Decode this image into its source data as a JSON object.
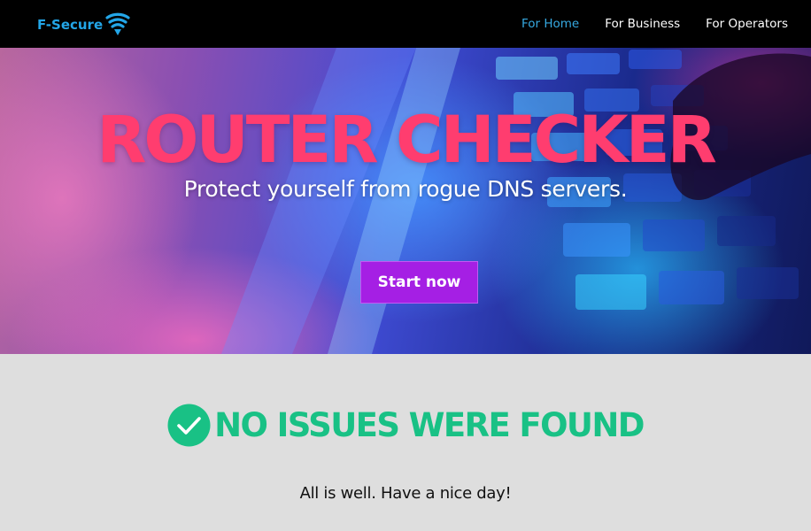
{
  "header": {
    "logo_text": "F-Secure",
    "logo_icon": "wifi-shield-icon",
    "nav": [
      {
        "label": "For Home",
        "active": true
      },
      {
        "label": "For Business",
        "active": false
      },
      {
        "label": "For Operators",
        "active": false
      }
    ]
  },
  "hero": {
    "title": "ROUTER CHECKER",
    "subtitle": "Protect yourself from rogue DNS servers.",
    "button_label": "Start now",
    "background_image": "keyboard-photo-neon"
  },
  "result": {
    "icon": "check-circle-icon",
    "title": "NO ISSUES WERE FOUND",
    "message": "All is well. Have a nice day!"
  },
  "colors": {
    "brand_blue": "#23a6e8",
    "nav_active": "#36a9e1",
    "title_pink": "#ff3d6f",
    "button_purple": "#a51fe4",
    "success_green": "#19c185",
    "header_bg": "#000000",
    "section_bg": "#dedede"
  }
}
